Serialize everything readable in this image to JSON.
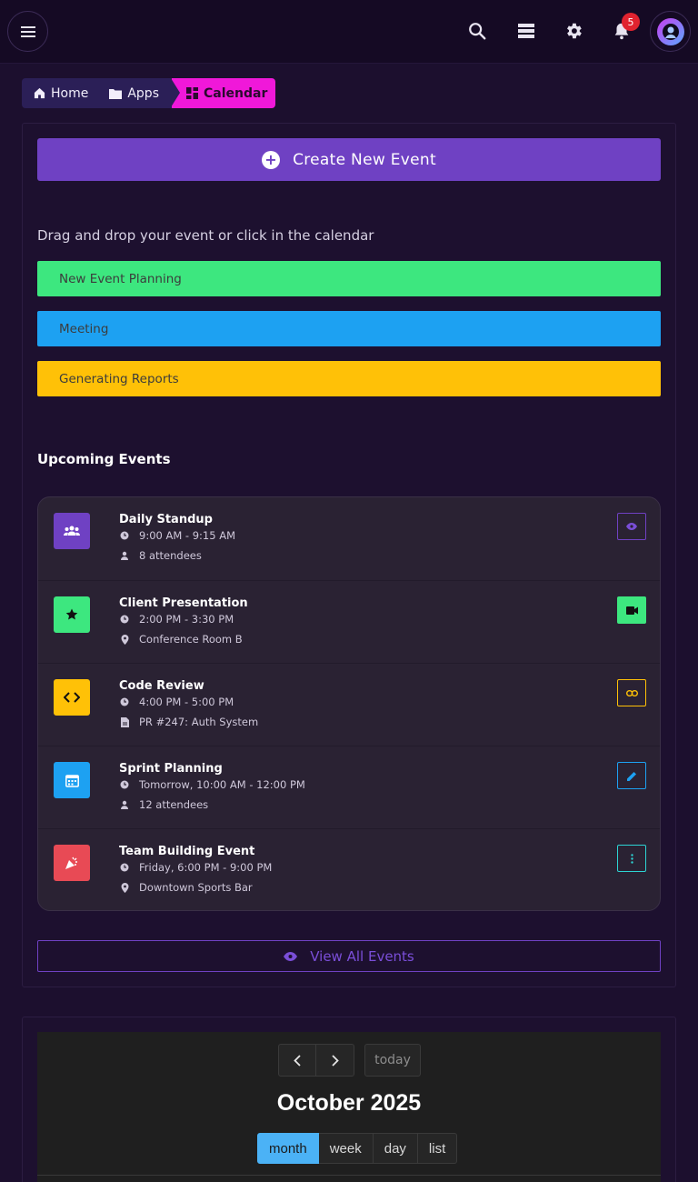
{
  "topbar": {
    "notification_count": "5",
    "icons": [
      "menu-icon",
      "search-icon",
      "layers-icon",
      "gear-icon",
      "bell-icon",
      "avatar"
    ]
  },
  "breadcrumb": {
    "items": [
      {
        "label": "Home",
        "icon": "home-icon"
      },
      {
        "label": "Apps",
        "icon": "folder-icon"
      },
      {
        "label": "Calendar",
        "icon": "dashboard-icon",
        "active": true
      }
    ]
  },
  "create_button_label": "Create New Event",
  "drag_hint": "Drag and drop your event or click in the calendar",
  "external_events": [
    {
      "label": "New Event Planning",
      "color": "#3de77f"
    },
    {
      "label": "Meeting",
      "color": "#1da1f2"
    },
    {
      "label": "Generating Reports",
      "color": "#ffc107"
    }
  ],
  "upcoming": {
    "title": "Upcoming Events",
    "events": [
      {
        "title": "Daily Standup",
        "time": "9:00 AM - 9:15 AM",
        "detail": "8 attendees",
        "detail_icon": "person-icon",
        "color": "#6f41c3",
        "icon": "group-icon",
        "action_icon": "eye-icon",
        "action_style": "outline"
      },
      {
        "title": "Client Presentation",
        "time": "2:00 PM - 3:30 PM",
        "detail": "Conference Room B",
        "detail_icon": "location-icon",
        "color": "#3de77f",
        "icon": "star-icon",
        "action_icon": "video-icon",
        "action_style": "filled"
      },
      {
        "title": "Code Review",
        "time": "4:00 PM - 5:00 PM",
        "detail": "PR #247: Auth System",
        "detail_icon": "document-icon",
        "color": "#ffc107",
        "icon": "code-icon",
        "action_icon": "link-icon",
        "action_style": "outline"
      },
      {
        "title": "Sprint Planning",
        "time": "Tomorrow, 10:00 AM - 12:00 PM",
        "detail": "12 attendees",
        "detail_icon": "person-icon",
        "color": "#1da1f2",
        "icon": "calendar-icon",
        "action_icon": "edit-icon",
        "action_style": "outline"
      },
      {
        "title": "Team Building Event",
        "time": "Friday, 6:00 PM - 9:00 PM",
        "detail": "Downtown Sports Bar",
        "detail_icon": "location-icon",
        "color": "#e84a55",
        "icon": "party-icon",
        "action_icon": "more-vertical-icon",
        "action_style": "outline-cyan"
      }
    ]
  },
  "view_all_label": "View All Events",
  "calendar": {
    "title": "October 2025",
    "today_label": "today",
    "views": [
      {
        "label": "month",
        "active": true
      },
      {
        "label": "week"
      },
      {
        "label": "day"
      },
      {
        "label": "list"
      }
    ]
  }
}
